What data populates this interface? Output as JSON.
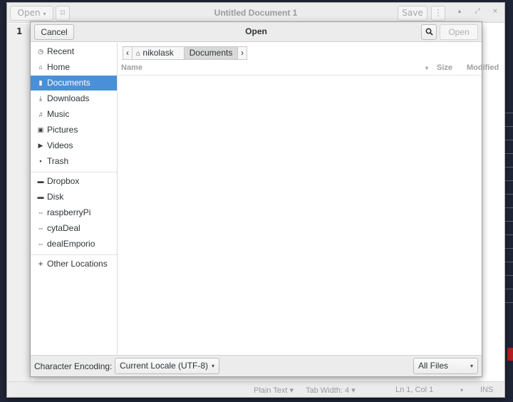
{
  "background_window": {
    "title": "Untitled Document 1",
    "open_label": "Open",
    "open_arrow": "▾",
    "pin_icon": "⌑",
    "save_label": "Save",
    "menu_icon": "⋮",
    "minimize_icon": "▴",
    "maximize_icon": "⤢",
    "close_icon": "×",
    "line_number": "1",
    "status": {
      "language": "Plain Text ▾",
      "tab_width": "Tab Width: 4 ▾",
      "position": "Ln 1, Col 1",
      "position_arrow": "▾",
      "mode": "INS"
    }
  },
  "dialog": {
    "title": "Open",
    "cancel_label": "Cancel",
    "open_label": "Open",
    "search_icon": "🔍",
    "sidebar": {
      "places": [
        {
          "label": "Recent",
          "icon": "◷",
          "name": "recent"
        },
        {
          "label": "Home",
          "icon": "⌂",
          "name": "home"
        },
        {
          "label": "Documents",
          "icon": "▮",
          "name": "documents",
          "selected": true
        },
        {
          "label": "Downloads",
          "icon": "⤓",
          "name": "downloads"
        },
        {
          "label": "Music",
          "icon": "♫",
          "name": "music"
        },
        {
          "label": "Pictures",
          "icon": "▣",
          "name": "pictures"
        },
        {
          "label": "Videos",
          "icon": "▶",
          "name": "videos"
        },
        {
          "label": "Trash",
          "icon": "▪",
          "name": "trash"
        }
      ],
      "bookmarks": [
        {
          "label": "Dropbox",
          "icon": "▬",
          "name": "dropbox"
        },
        {
          "label": "Disk",
          "icon": "▬",
          "name": "disk"
        },
        {
          "label": "raspberryPi",
          "icon": "⇔",
          "name": "raspberrypi"
        },
        {
          "label": "cytaDeal",
          "icon": "⇔",
          "name": "cytadeal"
        },
        {
          "label": "dealEmporio",
          "icon": "⇔",
          "name": "dealemporio"
        }
      ],
      "other": {
        "label": "Other Locations",
        "icon": "+"
      }
    },
    "pathbar": {
      "back_icon": "‹",
      "home_icon": "⌂",
      "home_label": "nikolask",
      "current_label": "Documents",
      "forward_icon": "›"
    },
    "columns": {
      "name": "Name",
      "sort_icon": "▾",
      "size": "Size",
      "modified": "Modified"
    },
    "footer": {
      "encoding_label": "Character Encoding:",
      "encoding_value": "Current Locale (UTF-8)",
      "filter_value": "All Files",
      "dropdown_icon": "▾"
    },
    "colors": {
      "selection": "#4a90d9",
      "header_bg": "#ececec"
    }
  }
}
